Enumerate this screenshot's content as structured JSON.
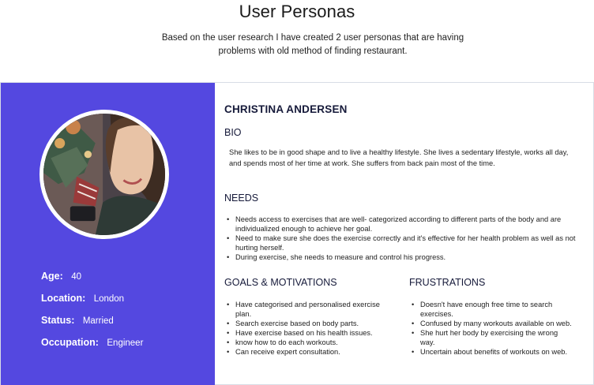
{
  "header": {
    "title": "User Personas",
    "intro_line1": "Based on the user research I have created 2 user personas that are having",
    "intro_line2": "problems with old method of finding restaurant."
  },
  "persona": {
    "name": "CHRISTINA ANDERSEN",
    "facts": [
      {
        "label": "Age:",
        "value": "40"
      },
      {
        "label": "Location:",
        "value": "London"
      },
      {
        "label": "Status:",
        "value": "Married"
      },
      {
        "label": "Occupation:",
        "value": "Engineer"
      }
    ],
    "bio": {
      "heading": "BIO",
      "line1": "She likes to be in good shape and to live a healthy lifestyle. She lives a sedentary lifestyle, works all day,",
      "line2": "and spends most of her time at work. She suffers from back pain most of the time."
    },
    "needs": {
      "heading": "NEEDS",
      "items": [
        {
          "line1": "Needs access to exercises that are well- categorized according to different parts of the body and are",
          "line2": "individualized enough to achieve her goal."
        },
        {
          "line1": "Need to make sure she does the exercise correctly and it's effective for her health problem as well as not",
          "line2": "hurting herself."
        },
        {
          "line1": "During exercise, she needs to measure and control his progress."
        }
      ]
    },
    "goals": {
      "heading": "GOALS & MOTIVATIONS",
      "items": [
        {
          "line1": "Have categorised and personalised exercise",
          "line2": "plan."
        },
        {
          "line1": "Search exercise based on body parts."
        },
        {
          "line1": "Have exercise based on his health issues."
        },
        {
          "line1": "know how to do each workouts."
        },
        {
          "line1": "Can receive expert consultation."
        }
      ]
    },
    "frustrations": {
      "heading": "FRUSTRATIONS",
      "items": [
        {
          "line1": "Doesn't have enough free time to search",
          "line2": "exercises."
        },
        {
          "line1": "Confused by many workouts available on web."
        },
        {
          "line1": "She hurt her body by exercising the wrong",
          "line2": "way."
        },
        {
          "line1": "Uncertain about benefits of workouts on web."
        }
      ]
    }
  },
  "colors": {
    "panel": "#5448e0",
    "heading": "#161a3a"
  }
}
